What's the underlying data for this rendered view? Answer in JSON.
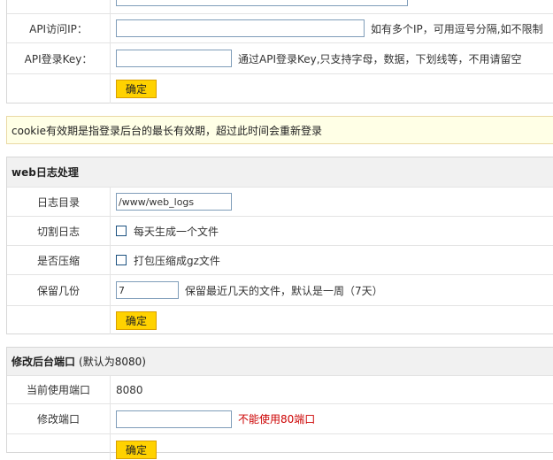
{
  "api": {
    "ip_label": "API访问IP：",
    "ip_value": "",
    "ip_hint": "如有多个IP，可用逗号分隔,如不限制",
    "key_label": "API登录Key：",
    "key_value": "",
    "key_hint": "通过API登录Key,只支持字母，数据，下划线等，不用请留空",
    "submit_label": "确定"
  },
  "notice": {
    "text": "cookie有效期是指登录后台的最长有效期，超过此时间会重新登录"
  },
  "weblog": {
    "title": "web日志处理",
    "dir_label": "日志目录",
    "dir_value": "/www/web_logs",
    "split_label": "切割日志",
    "split_option": "每天生成一个文件",
    "compress_label": "是否压缩",
    "compress_option": "打包压缩成gz文件",
    "keep_label": "保留几份",
    "keep_value": "7",
    "keep_hint": "保留最近几天的文件，默认是一周（7天）",
    "submit_label": "确定"
  },
  "port": {
    "title": "修改后台端口",
    "title_sub": "(默认为8080)",
    "current_label": "当前使用端口",
    "current_value": "8080",
    "change_label": "修改端口",
    "change_value": "",
    "change_hint": "不能使用80端口",
    "submit_label": "确定"
  },
  "colors": {
    "button_bg": "#ffd200",
    "notice_bg": "#ffffe6",
    "warning_text": "#cc0000"
  }
}
